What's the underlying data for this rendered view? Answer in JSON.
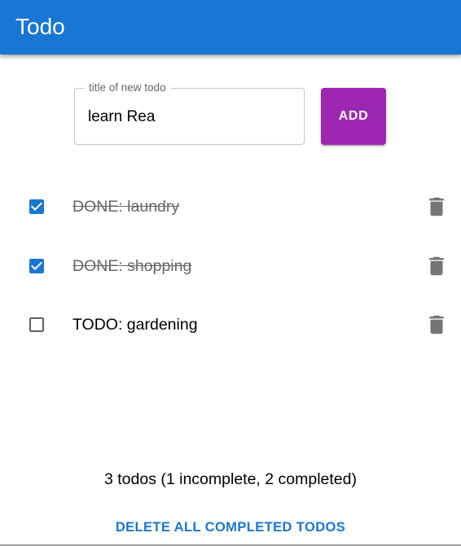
{
  "app_bar": {
    "title": "Todo",
    "color": "#1976d2"
  },
  "new_todo": {
    "label": "title of new todo",
    "value": "learn Rea",
    "add_label": "ADD",
    "add_color": "#9c27b0"
  },
  "todos": [
    {
      "text": "DONE: laundry",
      "completed": true,
      "checkbox_icon": "checkbox-checked-icon",
      "delete_icon": "trash-icon"
    },
    {
      "text": "DONE: shopping",
      "completed": true,
      "checkbox_icon": "checkbox-checked-icon",
      "delete_icon": "trash-icon"
    },
    {
      "text": "TODO: gardening",
      "completed": false,
      "checkbox_icon": "checkbox-unchecked-icon",
      "delete_icon": "trash-icon"
    }
  ],
  "summary": "3 todos (1 incomplete, 2 completed)",
  "delete_completed_label": "DELETE ALL COMPLETED TODOS",
  "colors": {
    "checkbox_checked": "#1976d2",
    "checkbox_unchecked": "#5f5f5f",
    "icon_grey": "#757575",
    "completed_text": "#666666"
  }
}
